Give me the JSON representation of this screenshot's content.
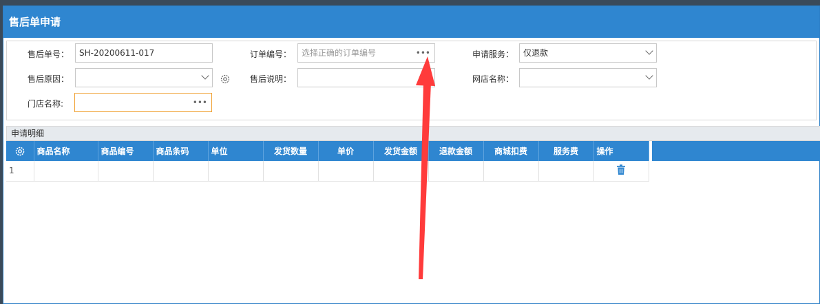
{
  "window": {
    "title": "售后单申请"
  },
  "form": {
    "aftersale_no": {
      "label": "售后单号：",
      "value": "SH-20200611-017"
    },
    "order_no": {
      "label": "订单编号：",
      "placeholder": "选择正确的订单编号"
    },
    "service": {
      "label": "申请服务：",
      "value": "仅退款"
    },
    "reason": {
      "label": "售后原因：",
      "value": ""
    },
    "desc": {
      "label": "售后说明：",
      "value": ""
    },
    "shop": {
      "label": "网店名称：",
      "value": ""
    },
    "store": {
      "label": "门店名称:",
      "value": ""
    }
  },
  "details": {
    "section_label": "申请明细",
    "columns": [
      "商品名称",
      "商品编号",
      "商品条码",
      "单位",
      "发货数量",
      "单价",
      "发货金额",
      "退款金额",
      "商城扣费",
      "服务费",
      "操作"
    ],
    "rows": [
      {
        "index": "1"
      }
    ]
  },
  "colors": {
    "titlebar": "#2f86d0",
    "header": "#2f86d0",
    "arrow": "#ff3b3b",
    "trash": "#2f86d0"
  }
}
